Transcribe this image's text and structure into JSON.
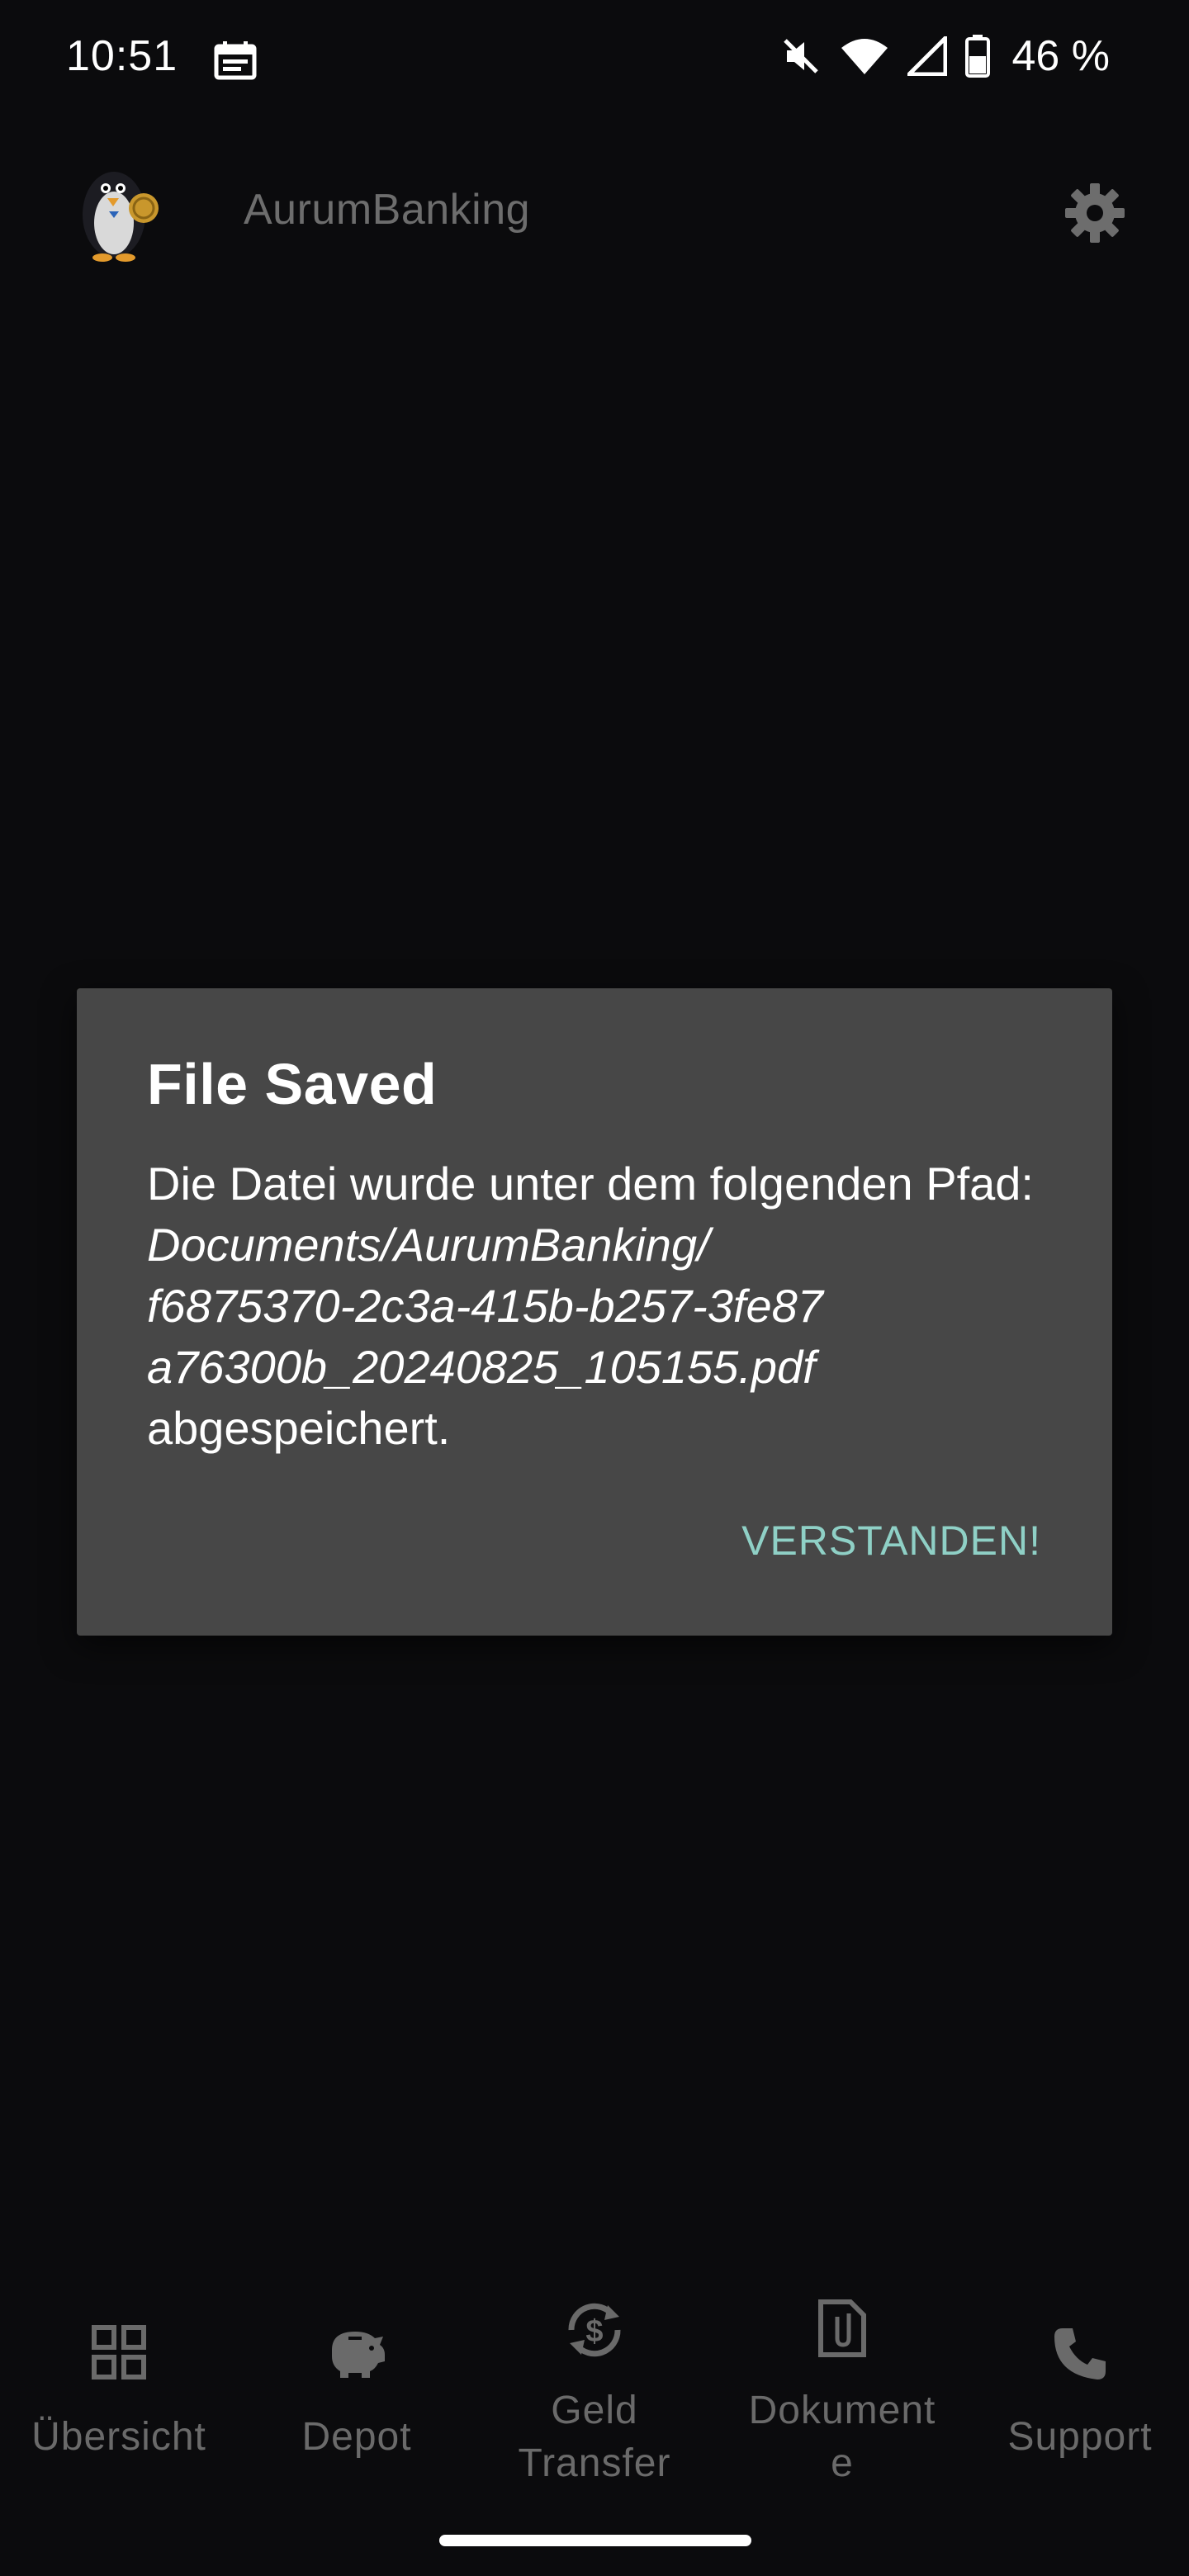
{
  "status_bar": {
    "time": "10:51",
    "battery": "46 %"
  },
  "app_bar": {
    "title": "AurumBanking"
  },
  "dialog": {
    "title": "File Saved",
    "body_prefix": "Die Datei wurde unter dem folgenden Pfad:",
    "path_line1": "Documents/AurumBanking/",
    "path_line2": "f6875370-2c3a-415b-b257-3fe87",
    "path_line3": "a76300b_20240825_105155.pdf",
    "body_suffix": "abgespeichert.",
    "button": "VERSTANDEN!",
    "button_color": "#8fd0c6"
  },
  "bottom_nav": {
    "items": [
      {
        "icon": "grid-icon",
        "label": "Übersicht"
      },
      {
        "icon": "piggy-bank-icon",
        "label": "Depot"
      },
      {
        "icon": "money-transfer-icon",
        "label_line1": "Geld",
        "label_line2": "Transfer"
      },
      {
        "icon": "document-icon",
        "label_line1": "Dokument",
        "label_line2": "e"
      },
      {
        "icon": "phone-icon",
        "label": "Support"
      }
    ]
  }
}
